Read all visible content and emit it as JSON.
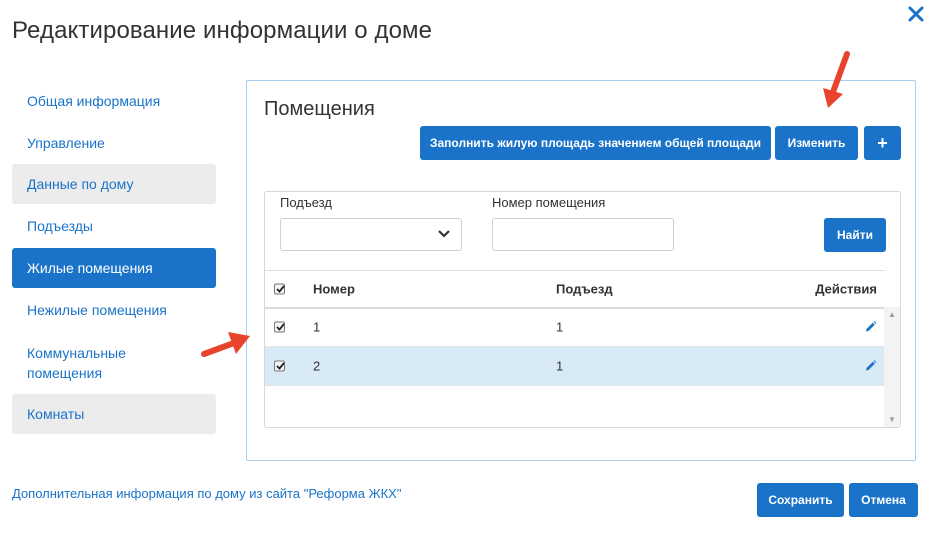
{
  "dialog": {
    "title": "Редактирование информации о доме",
    "close_icon": "close-icon"
  },
  "sidebar": {
    "items": [
      {
        "label": "Общая информация"
      },
      {
        "label": "Управление"
      },
      {
        "label": "Данные по дому"
      },
      {
        "label": "Подъезды"
      },
      {
        "label": "Жилые помещения"
      },
      {
        "label": "Нежилые помещения"
      },
      {
        "label": "Коммунальные помещения"
      },
      {
        "label": "Комнаты"
      }
    ]
  },
  "panel": {
    "title": "Помещения",
    "fill_button": "Заполнить жилую площадь значением общей площади",
    "edit_button": "Изменить",
    "add_button": "+"
  },
  "filters": {
    "entrance_label": "Подъезд",
    "entrance_value": "",
    "room_number_label": "Номер помещения",
    "room_number_value": "",
    "find_button": "Найти"
  },
  "table": {
    "columns": [
      "Номер",
      "Подъезд",
      "Действия"
    ],
    "rows": [
      {
        "number": "1",
        "entrance": "1",
        "checked": true,
        "selected": false
      },
      {
        "number": "2",
        "entrance": "1",
        "checked": true,
        "selected": true
      }
    ]
  },
  "footer": {
    "link": "Дополнительная информация по дому из сайта \"Реформа ЖКХ\"",
    "save_button": "Сохранить",
    "cancel_button": "Отмена"
  },
  "colors": {
    "accent": "#1a73c8",
    "annotation_arrow": "#e8432d",
    "selected_row": "#d9eaf7"
  }
}
